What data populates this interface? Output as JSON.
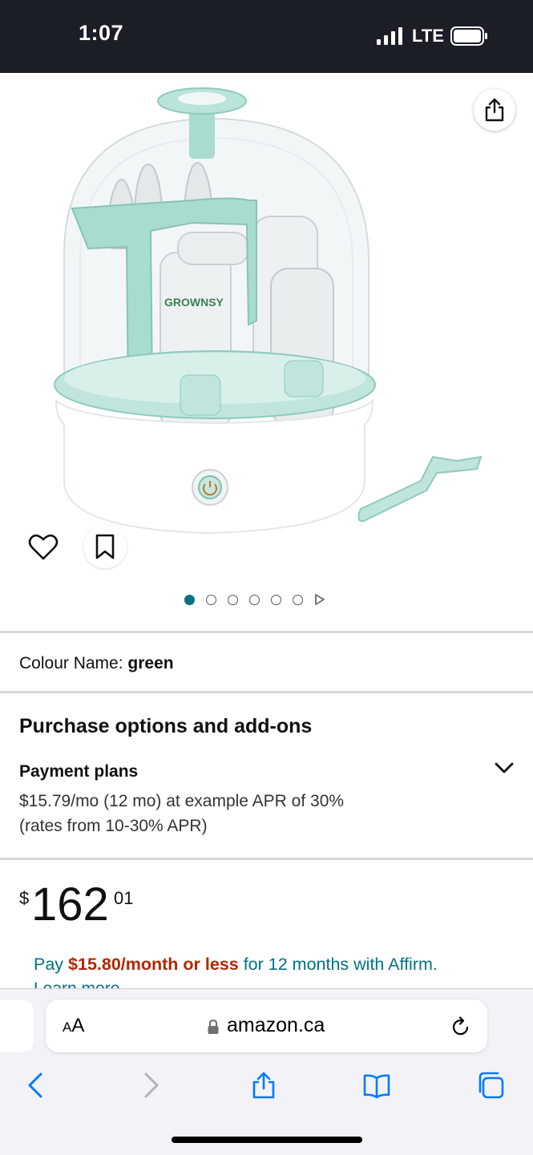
{
  "status_bar": {
    "time": "1:07",
    "network": "LTE"
  },
  "product": {
    "image_brand_text": "GROWNSY",
    "colour_label": "Colour Name:",
    "colour_value": "green",
    "carousel": {
      "total_dots": 6,
      "active_index": 0
    }
  },
  "purchase": {
    "title": "Purchase options and add-ons",
    "payment_title": "Payment plans",
    "payment_line1": "$15.79/mo (12 mo) at example APR of 30%",
    "payment_line2": "(rates from 10-30% APR)"
  },
  "price": {
    "symbol": "$",
    "whole": "162",
    "fraction": "01"
  },
  "affirm": {
    "prefix": "Pay ",
    "amount": "$15.80/month or less",
    "suffix": " for 12 months with Affirm.",
    "learn_more": "Learn more"
  },
  "browser": {
    "aa_label_big": "A",
    "aa_label_small": "A",
    "url": "amazon.ca"
  },
  "colors": {
    "accent_teal": "#007185",
    "price_red": "#b12704",
    "product_green": "#a8dcd0",
    "status_bar_bg": "#1b1e27"
  }
}
